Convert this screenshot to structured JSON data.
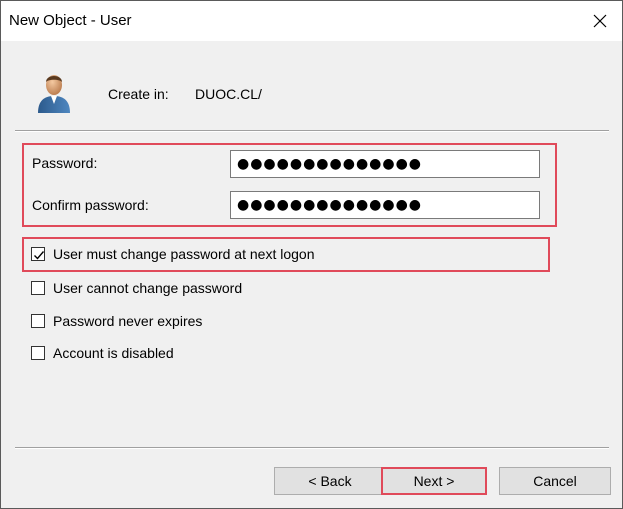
{
  "window": {
    "title": "New Object - User"
  },
  "header": {
    "icon": "user-icon",
    "create_in_label": "Create in:",
    "create_in_value": "DUOC.CL/"
  },
  "form": {
    "password_label": "Password:",
    "password_value": "●●●●●●●●●●●●●●",
    "confirm_label": "Confirm password:",
    "confirm_value": "●●●●●●●●●●●●●●"
  },
  "options": [
    {
      "label": "User must change password at next logon",
      "checked": true
    },
    {
      "label": "User cannot change password",
      "checked": false
    },
    {
      "label": "Password never expires",
      "checked": false
    },
    {
      "label": "Account is disabled",
      "checked": false
    }
  ],
  "buttons": {
    "back": "< Back",
    "next": "Next >",
    "cancel": "Cancel"
  },
  "colors": {
    "highlight": "#e04a5a",
    "dialog_bg": "#f0f0f0"
  }
}
